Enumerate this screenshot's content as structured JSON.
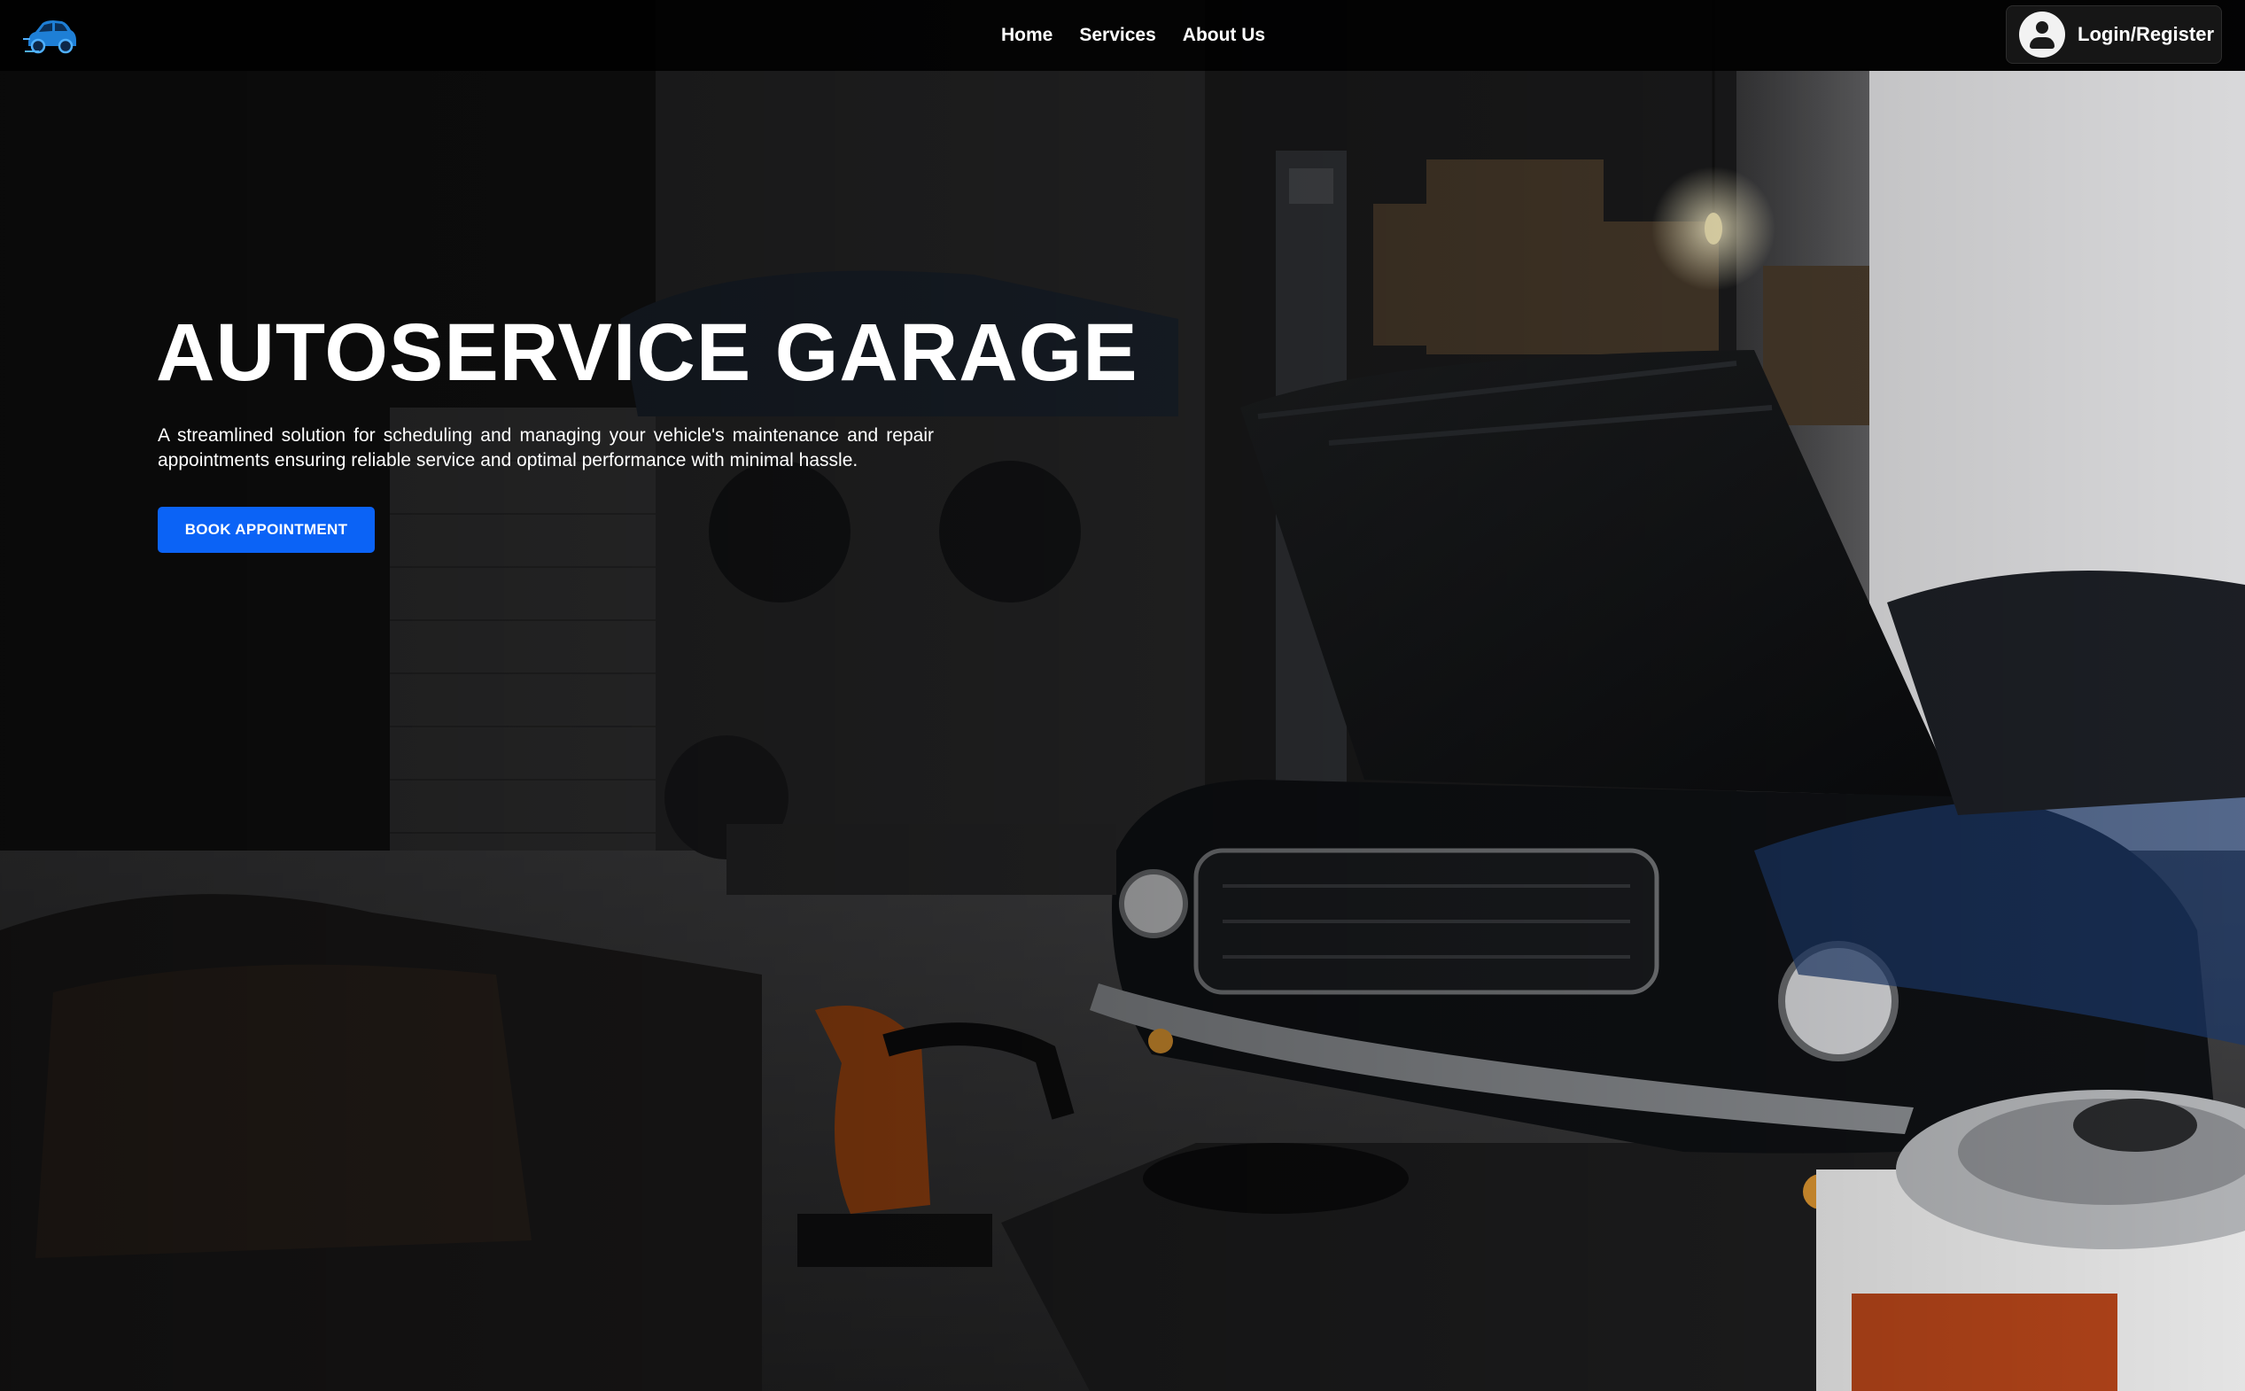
{
  "navbar": {
    "logo_icon": "car-logo-icon",
    "links": [
      {
        "label": "Home"
      },
      {
        "label": "Services"
      },
      {
        "label": "About Us"
      }
    ],
    "login": {
      "icon": "user-avatar-icon",
      "label": "Login/Register"
    }
  },
  "hero": {
    "title": "AUTOSERVICE GARAGE",
    "description": "A streamlined solution for scheduling and managing your vehicle's maintenance and repair appointments ensuring reliable service and optimal performance with minimal hassle.",
    "cta_label": "BOOK APPOINTMENT"
  },
  "colors": {
    "navbar_bg": "#000000",
    "accent_blue": "#0b63f6",
    "text": "#ffffff"
  }
}
